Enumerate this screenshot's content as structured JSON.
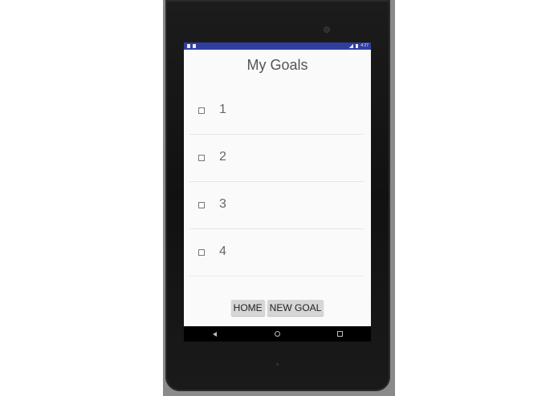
{
  "status_bar": {
    "time": "4:27"
  },
  "app": {
    "title": "My Goals"
  },
  "goals": [
    {
      "label": "1",
      "checked": false
    },
    {
      "label": "2",
      "checked": false
    },
    {
      "label": "3",
      "checked": false
    },
    {
      "label": "4",
      "checked": false
    }
  ],
  "buttons": {
    "home": "HOME",
    "new_goal": "NEW GOAL"
  },
  "colors": {
    "status_bar": "#303f9f",
    "screen_bg": "#fafafa",
    "button_bg": "#d6d6d6"
  },
  "nav_icons": [
    "back-icon",
    "home-circle-icon",
    "recents-square-icon"
  ]
}
